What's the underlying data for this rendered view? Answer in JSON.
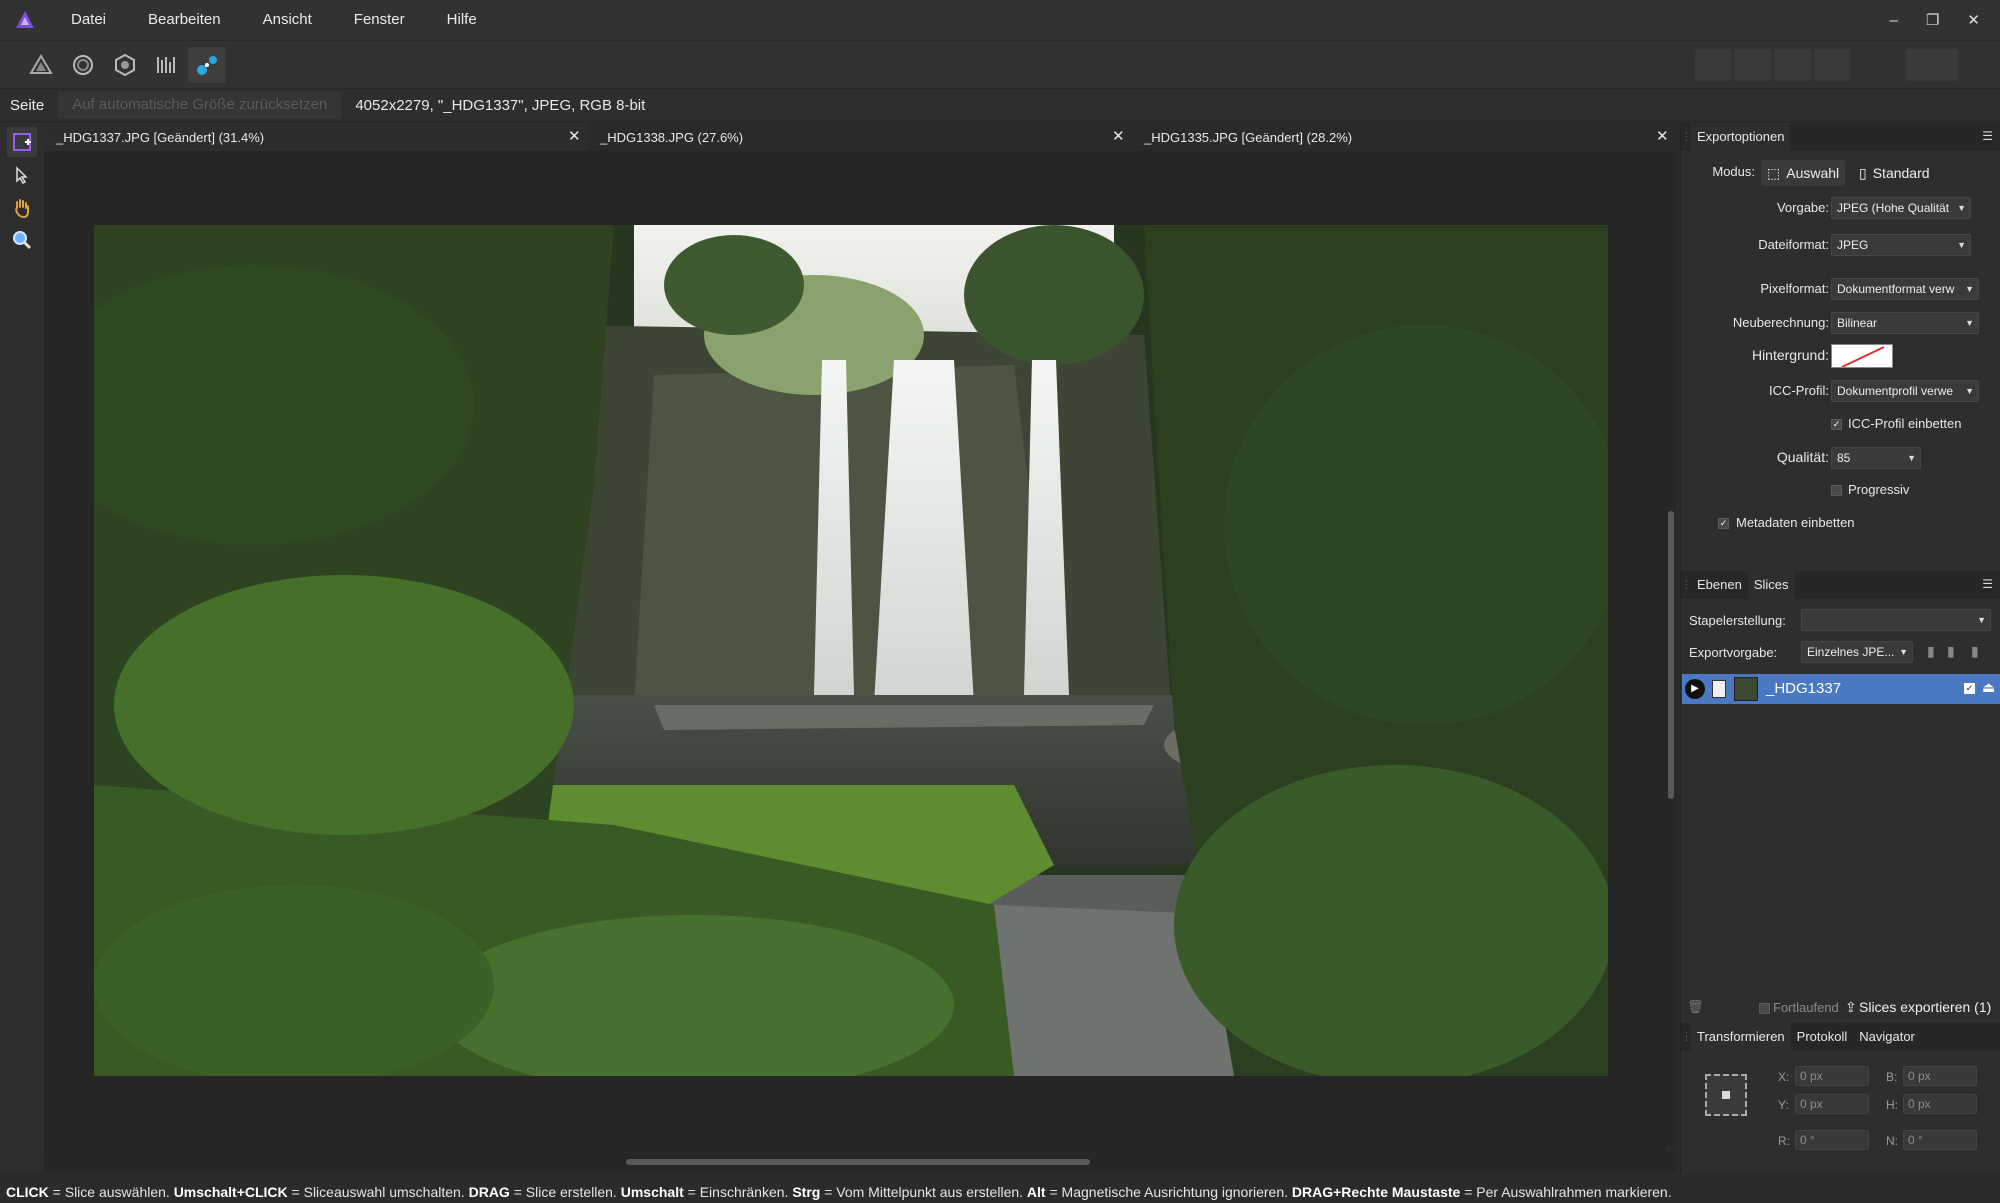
{
  "menu": {
    "items": [
      "Datei",
      "Bearbeiten",
      "Ansicht",
      "Fenster",
      "Hilfe"
    ],
    "window_controls": [
      "–",
      "❐",
      "✕"
    ]
  },
  "context": {
    "page_label": "Seite",
    "reset_button": "Auf automatische Größe zurücksetzen",
    "info": "4052x2279, \"_HDG1337\", JPEG, RGB 8-bit"
  },
  "tabs": [
    {
      "label": "_HDG1337.JPG [Geändert] (31.4%)",
      "close": "✕"
    },
    {
      "label": "_HDG1338.JPG (27.6%)",
      "close": "✕"
    },
    {
      "label": "_HDG1335.JPG [Geändert] (28.2%)",
      "close": "✕"
    }
  ],
  "export": {
    "tab": "Exportoptionen",
    "mode_label": "Modus:",
    "mode_selection": "Auswahl",
    "mode_standard": "Standard",
    "preset_label": "Vorgabe:",
    "preset_value": "JPEG (Hohe Qualität",
    "format_label": "Dateiformat:",
    "format_value": "JPEG",
    "pixel_label": "Pixelformat:",
    "pixel_value": "Dokumentformat verw",
    "resample_label": "Neuberechnung:",
    "resample_value": "Bilinear",
    "bg_label": "Hintergrund:",
    "icc_label": "ICC-Profil:",
    "icc_value": "Dokumentprofil verwe",
    "icc_embed_label": "ICC-Profil einbetten",
    "quality_label": "Qualität:",
    "quality_value": "85",
    "progressive_label": "Progressiv",
    "metadata_label": "Metadaten einbetten",
    "check": "✓"
  },
  "slices": {
    "tab_layers": "Ebenen",
    "tab_slices": "Slices",
    "batch_label": "Stapelerstellung:",
    "batch_value": "",
    "export_preset_label": "Exportvorgabe:",
    "export_preset_value": "Einzelnes JPE...",
    "slice_name": "_HDG1337",
    "continuous_label": "Fortlaufend",
    "export_button": "Slices exportieren (1)"
  },
  "transform": {
    "tabs": [
      "Transformieren",
      "Protokoll",
      "Navigator"
    ],
    "x_label": "X:",
    "x_value": "0 px",
    "y_label": "Y:",
    "y_value": "0 px",
    "w_label": "B:",
    "w_value": "0 px",
    "h_label": "H:",
    "h_value": "0 px",
    "r_label": "R:",
    "r_value": "0 °",
    "s_label": "N:",
    "s_value": "0 °"
  },
  "status": {
    "parts": [
      {
        "b": "CLICK",
        "t": " = Slice auswählen. "
      },
      {
        "b": "Umschalt+CLICK",
        "t": " = Sliceauswahl umschalten. "
      },
      {
        "b": "DRAG",
        "t": " = Slice erstellen. "
      },
      {
        "b": "Umschalt",
        "t": " = Einschränken. "
      },
      {
        "b": "Strg",
        "t": " = Vom Mittelpunkt aus erstellen. "
      },
      {
        "b": "Alt",
        "t": " = Magnetische Ausrichtung ignorieren. "
      },
      {
        "b": "DRAG+Rechte Maustaste",
        "t": " = Per Auswahlrahmen markieren."
      }
    ]
  },
  "colors": {
    "accent": "#4a78c2",
    "persona_active": "#2aa7e0",
    "logo": "#7b4fd6"
  }
}
